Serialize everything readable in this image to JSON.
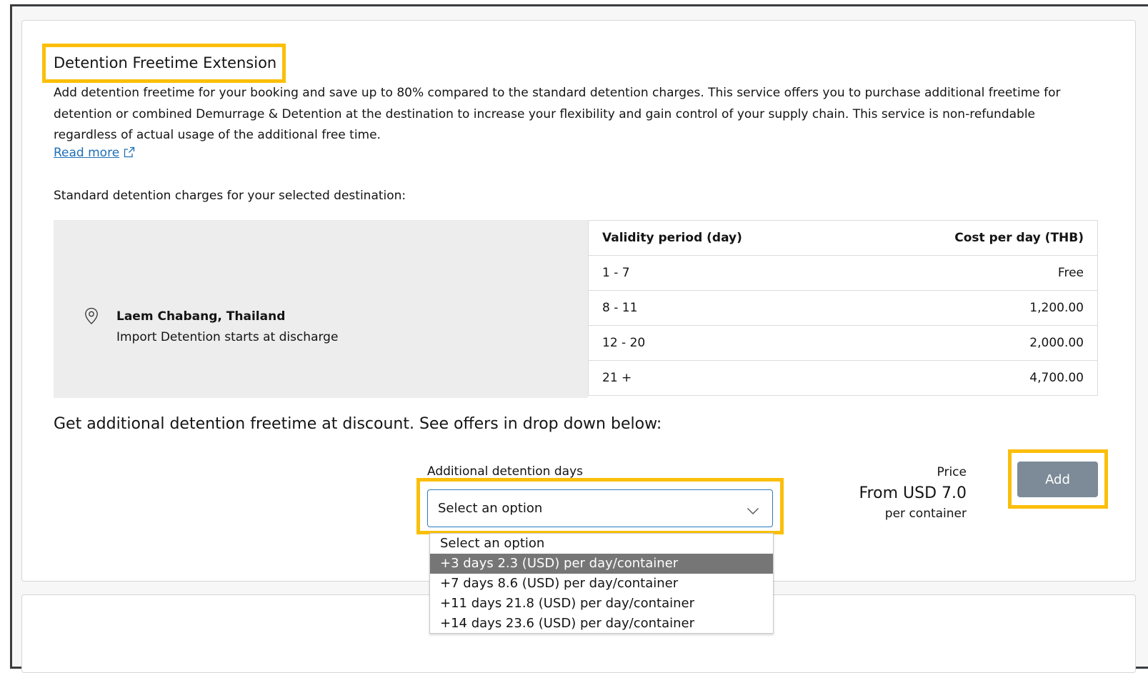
{
  "section": {
    "title": "Detention Freetime Extension",
    "description": "Add detention freetime for your booking and save up to 80% compared to the standard detention charges. This service offers you to purchase additional freetime for detention or combined Demurrage & Detention at the destination to increase your flexibility and gain control of your supply chain. This service is non-refundable regardless of actual usage of the additional free time.",
    "read_more_label": "Read more",
    "standard_charges_label": "Standard detention charges for your selected destination:"
  },
  "location": {
    "name": "Laem Chabang, Thailand",
    "subtitle": "Import Detention starts at discharge",
    "icon": "map-pin-icon"
  },
  "rates_table": {
    "headers": [
      "Validity period (day)",
      "Cost per day (THB)"
    ],
    "rows": [
      [
        "1 - 7",
        "Free"
      ],
      [
        "8 - 11",
        "1,200.00"
      ],
      [
        "12 - 20",
        "2,000.00"
      ],
      [
        "21 +",
        "4,700.00"
      ]
    ]
  },
  "offer": {
    "heading": "Get additional detention freetime at discount. See offers in drop down below:",
    "select_label": "Additional detention days",
    "select_value": "Select an option",
    "options": [
      "Select an option",
      "+3 days 2.3 (USD) per day/container",
      "+7 days 8.6 (USD) per day/container",
      "+11 days 21.8 (USD) per day/container",
      "+14 days 23.6 (USD) per day/container"
    ],
    "highlighted_option_index": 1
  },
  "price": {
    "label": "Price",
    "value": "From USD 7.0",
    "unit": "per container"
  },
  "add_button_label": "Add",
  "colors": {
    "highlight": "#fbbf0a",
    "link": "#1f6fb5",
    "button": "#7c8b97",
    "panel": "#ededed",
    "option_active": "#767676"
  }
}
